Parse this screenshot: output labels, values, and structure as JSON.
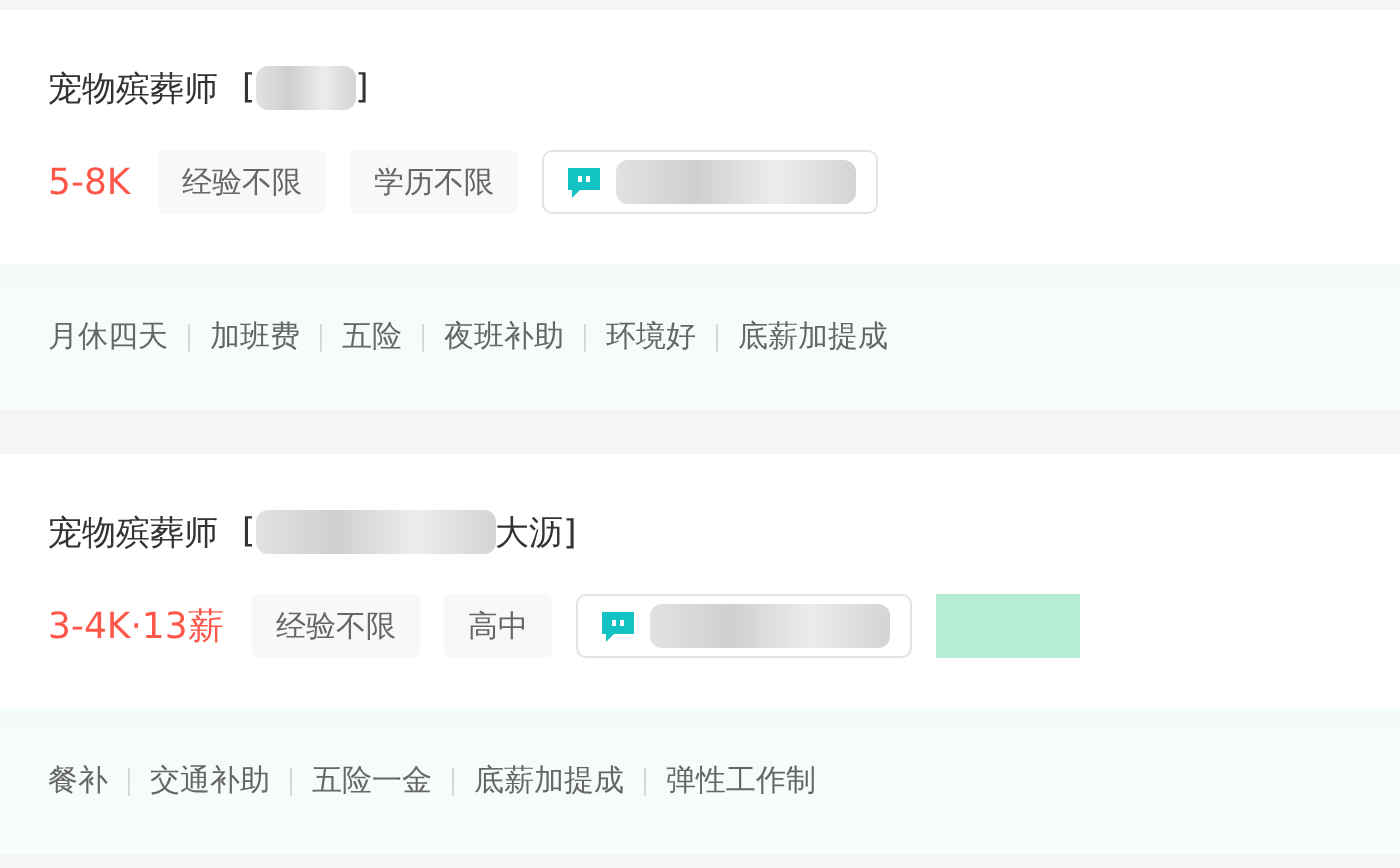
{
  "jobs": [
    {
      "title": "宠物殡葬师",
      "location": [
        {
          "kind": "text",
          "text": "["
        },
        {
          "kind": "redacted"
        },
        {
          "kind": "text",
          "text": "]"
        }
      ],
      "salary": "5-8K",
      "tags": [
        "经验不限",
        "学历不限"
      ],
      "chat": [
        {
          "kind": "redacted"
        }
      ],
      "benefits": [
        "月休四天",
        "加班费",
        "五险",
        "夜班补助",
        "环境好",
        "底薪加提成"
      ]
    },
    {
      "title": "宠物殡葬师",
      "location": [
        {
          "kind": "text",
          "text": "["
        },
        {
          "kind": "redacted"
        },
        {
          "kind": "text",
          "text": "大沥]"
        }
      ],
      "salary": "3-4K·13薪",
      "tags": [
        "经验不限",
        "高中"
      ],
      "chat": [
        {
          "kind": "redacted"
        }
      ],
      "after_chat": [
        {
          "kind": "redacted",
          "color": "#b4ecd4"
        }
      ],
      "benefits": [
        "餐补",
        "交通补助",
        "五险一金",
        "底薪加提成",
        "弹性工作制"
      ]
    }
  ]
}
